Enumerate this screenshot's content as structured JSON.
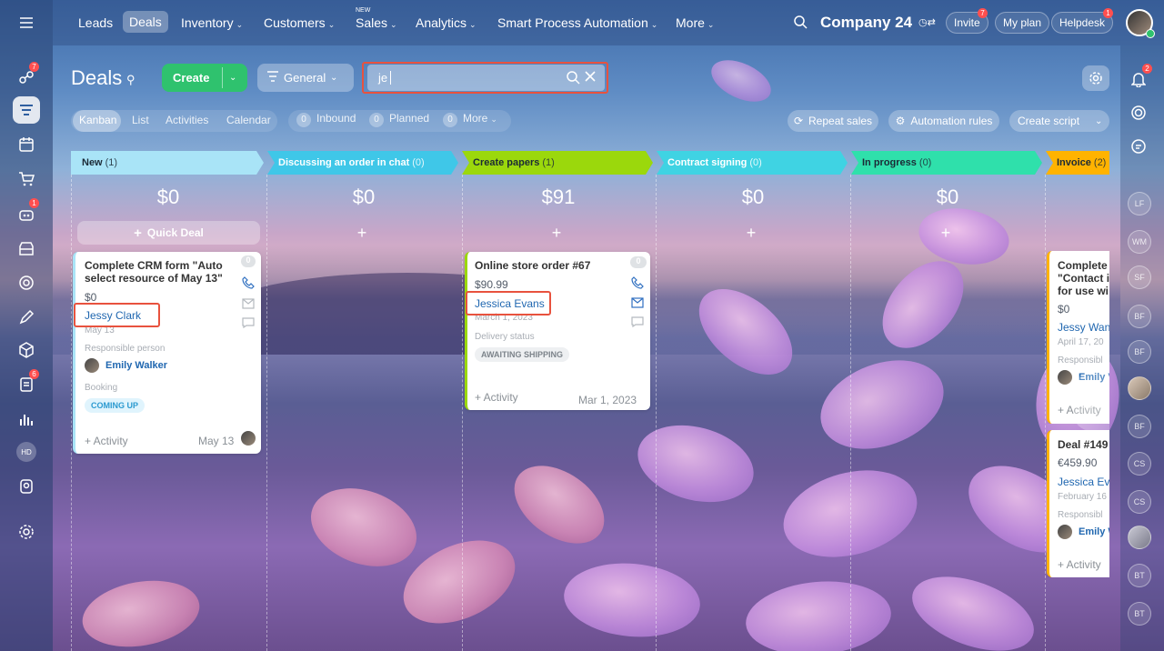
{
  "top_nav": {
    "items": [
      {
        "label": "Leads",
        "chevron": false
      },
      {
        "label": "Deals",
        "chevron": false,
        "active": true
      },
      {
        "label": "Inventory",
        "chevron": true
      },
      {
        "label": "Customers",
        "chevron": true
      },
      {
        "label": "Sales",
        "chevron": true,
        "superscript": "NEW"
      },
      {
        "label": "Analytics",
        "chevron": true
      },
      {
        "label": "Smart Process Automation",
        "chevron": true
      },
      {
        "label": "More",
        "chevron": true
      }
    ],
    "company": "Company 24",
    "invite": "Invite",
    "invite_badge": "7",
    "my_plan": "My plan",
    "helpdesk": "Helpdesk",
    "helpdesk_badge": "1"
  },
  "left_sidebar": {
    "badges": {
      "activity": "7",
      "bot": "1",
      "docs": "6"
    },
    "initials": "HD"
  },
  "right_sidebar": {
    "notif_badge": "2",
    "avatars": [
      "LF",
      "WM",
      "SF",
      "BF",
      "BF",
      "BF",
      "CS",
      "CS",
      "BT",
      "BT"
    ]
  },
  "toolbar": {
    "title": "Deals",
    "create": "Create",
    "filter": "General",
    "search_value": "je",
    "repeat_sales": "Repeat sales",
    "automation_rules": "Automation rules",
    "create_script": "Create script"
  },
  "view_tabs": {
    "kanban": "Kanban",
    "list": "List",
    "activities": "Activities",
    "calendar": "Calendar",
    "inbound": "Inbound",
    "inbound_count": "0",
    "planned": "Planned",
    "planned_count": "0",
    "more": "More",
    "more_count": "0"
  },
  "columns": [
    {
      "title": "New",
      "count": "(1)",
      "sum": "$0",
      "color": "#a9e4f7",
      "text_color": "#1c2a36",
      "quick_deal": "Quick Deal"
    },
    {
      "title": "Discussing an order in chat",
      "count": "(0)",
      "sum": "$0",
      "color": "#3fc7e8",
      "text_color": "#ffffff"
    },
    {
      "title": "Create papers",
      "count": "(1)",
      "sum": "$91",
      "color": "#9bd80c",
      "text_color": "#1c2a36"
    },
    {
      "title": "Contract signing",
      "count": "(0)",
      "sum": "$0",
      "color": "#3fd3e3",
      "text_color": "#ffffff"
    },
    {
      "title": "In progress",
      "count": "(0)",
      "sum": "$0",
      "color": "#2fe0ab",
      "text_color": "#1c2a36"
    },
    {
      "title": "Invoice",
      "count": "(2)",
      "sum": "",
      "color": "#ffb300",
      "text_color": "#1c2a36"
    }
  ],
  "cards": {
    "c1": {
      "title": "Complete CRM form \"Auto select resource of May 13\"",
      "amount": "$0",
      "contact": "Jessy Clark",
      "date": "May 13",
      "resp_label": "Responsible person",
      "resp_name": "Emily Walker",
      "booking_label": "Booking",
      "booking_tag": "COMING UP",
      "activity": "+ Activity",
      "foot_date": "May 13",
      "counter": "0"
    },
    "c2": {
      "title": "Online store order #67",
      "amount": "$90.99",
      "contact": "Jessica Evans",
      "date": "March 1, 2023",
      "status_label": "Delivery status",
      "status_tag": "AWAITING SHIPPING",
      "activity": "+ Activity",
      "foot_date": "Mar 1, 2023",
      "counter": "0"
    },
    "c3": {
      "title": "Complete \"Contact i for use wi",
      "amount": "$0",
      "contact": "Jessy Wan",
      "date": "April 17, 20",
      "resp_label": "Responsibl",
      "resp_name": "Emily V",
      "activity": "+ Activity"
    },
    "c4": {
      "title": "Deal #149",
      "amount": "€459.90",
      "contact": "Jessica Ev",
      "date": "February 16",
      "resp_label": "Responsibl",
      "resp_name": "Emily W",
      "activity": "+ Activity"
    }
  },
  "colors": {
    "create_green": "#2fc26e",
    "highlight": "#e8523e",
    "link": "#2067b0"
  }
}
